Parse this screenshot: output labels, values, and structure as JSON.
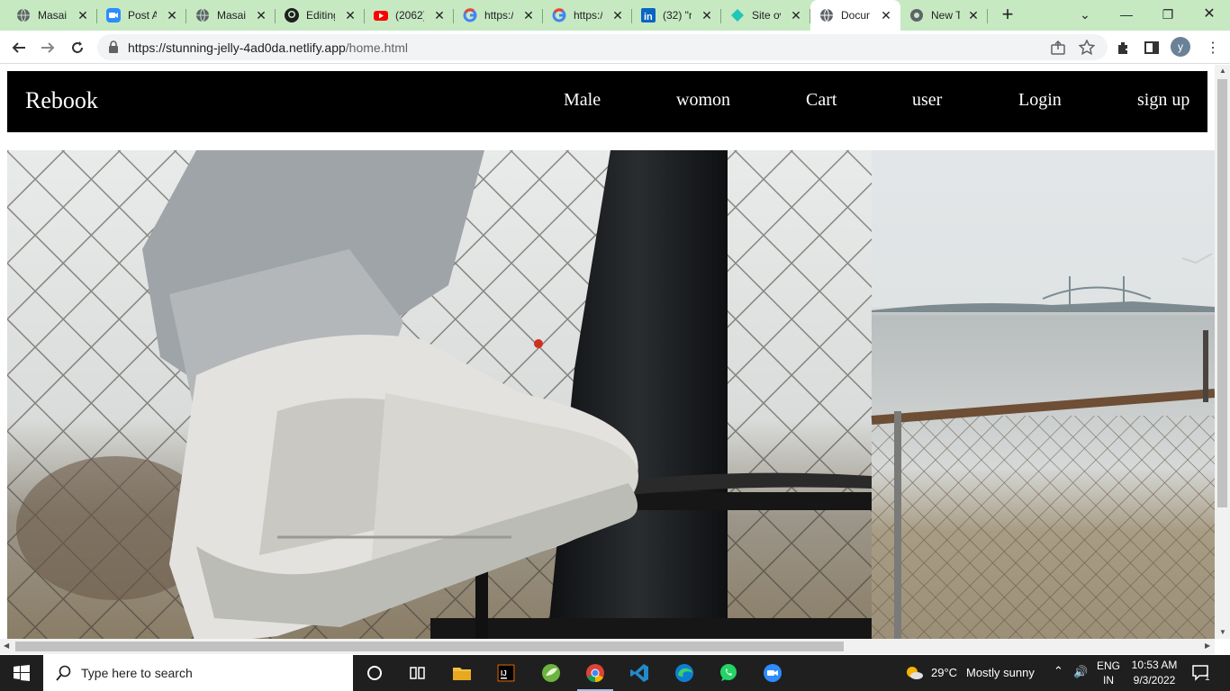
{
  "browser": {
    "tabs": [
      {
        "title": "Masai",
        "icon": "globe-icon"
      },
      {
        "title": "Post A",
        "icon": "zoom-icon"
      },
      {
        "title": "Masai",
        "icon": "globe-icon"
      },
      {
        "title": "Editing",
        "icon": "github-icon"
      },
      {
        "title": "(2062)",
        "icon": "youtube-icon"
      },
      {
        "title": "https:/",
        "icon": "google-icon"
      },
      {
        "title": "https:/",
        "icon": "google-icon"
      },
      {
        "title": "(32) \"r",
        "icon": "linkedin-icon"
      },
      {
        "title": "Site ov",
        "icon": "netlify-icon"
      },
      {
        "title": "Docun",
        "icon": "globe-icon",
        "active": true
      },
      {
        "title": "New T",
        "icon": "chrome-icon"
      }
    ],
    "url_host": "https://stunning-jelly-4ad0da.netlify.app",
    "url_path": "/home.html",
    "profile_initial": "y"
  },
  "site": {
    "brand": "Rebook",
    "nav": {
      "male": "Male",
      "women": "womon",
      "cart": "Cart",
      "user": "user",
      "login": "Login",
      "signup": "sign up"
    }
  },
  "taskbar": {
    "search_placeholder": "Type here to search",
    "weather_temp": "29°C",
    "weather_text": "Mostly sunny",
    "lang": "ENG",
    "region": "IN",
    "time": "10:53 AM",
    "date": "9/3/2022",
    "notification_count": "1"
  },
  "colors": {
    "tabstrip": "#c6e9c2",
    "nav_bg": "#000000",
    "taskbar": "#1f1f1f"
  }
}
